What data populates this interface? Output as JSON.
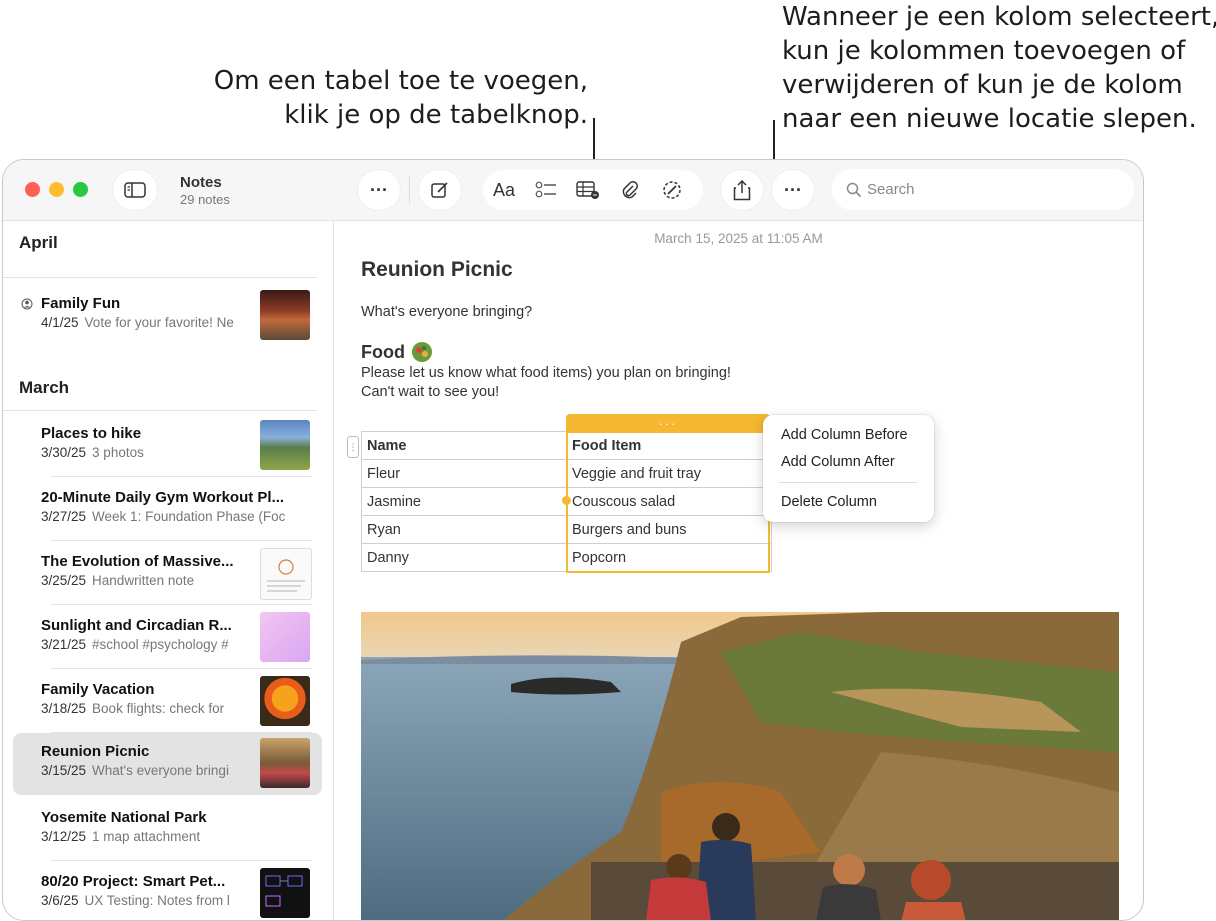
{
  "callouts": {
    "left": [
      "Om een tabel toe te voegen,",
      "klik je op de tabelknop."
    ],
    "right": [
      "Wanneer je een kolom selecteert,",
      "kun je kolommen toevoegen of",
      "verwijderen of kun je de kolom",
      "naar een nieuwe locatie slepen."
    ]
  },
  "app": {
    "title": "Notes",
    "subtitle": "29 notes"
  },
  "toolbar": {
    "format_label": "Aa",
    "search_placeholder": "Search"
  },
  "sidebar": {
    "sections": [
      {
        "title": "April",
        "notes": [
          {
            "title": "Family Fun",
            "date": "4/1/25",
            "snippet": "Vote for your favorite! Ne",
            "shared": true
          }
        ]
      },
      {
        "title": "March",
        "notes": [
          {
            "title": "Places to hike",
            "date": "3/30/25",
            "snippet": "3 photos"
          },
          {
            "title": "20-Minute Daily Gym Workout Pl...",
            "date": "3/27/25",
            "snippet": "Week 1: Foundation Phase (Foc"
          },
          {
            "title": "The Evolution of Massive...",
            "date": "3/25/25",
            "snippet": "Handwritten note"
          },
          {
            "title": "Sunlight and Circadian R...",
            "date": "3/21/25",
            "snippet": "#school #psychology #"
          },
          {
            "title": "Family Vacation",
            "date": "3/18/25",
            "snippet": "Book flights: check for"
          },
          {
            "title": "Reunion Picnic",
            "date": "3/15/25",
            "snippet": "What's everyone bringi",
            "selected": true
          },
          {
            "title": "Yosemite National Park",
            "date": "3/12/25",
            "snippet": "1 map attachment"
          },
          {
            "title": "80/20 Project: Smart Pet...",
            "date": "3/6/25",
            "snippet": "UX Testing: Notes from l"
          }
        ]
      }
    ]
  },
  "note": {
    "timestamp": "March 15, 2025 at 11:05 AM",
    "title": "Reunion Picnic",
    "question": "What's everyone bringing?",
    "section_title": "Food",
    "body_line1": "Please let us know what food items) you plan on bringing!",
    "body_line2": "Can't wait to see you!",
    "table": {
      "headers": [
        "Name",
        "Food Item"
      ],
      "rows": [
        [
          "Fleur",
          "Veggie and fruit tray"
        ],
        [
          "Jasmine",
          "Couscous salad"
        ],
        [
          "Ryan",
          "Burgers and buns"
        ],
        [
          "Danny",
          "Popcorn"
        ]
      ]
    }
  },
  "context_menu": {
    "add_before": "Add Column Before",
    "add_after": "Add Column After",
    "delete": "Delete Column"
  }
}
